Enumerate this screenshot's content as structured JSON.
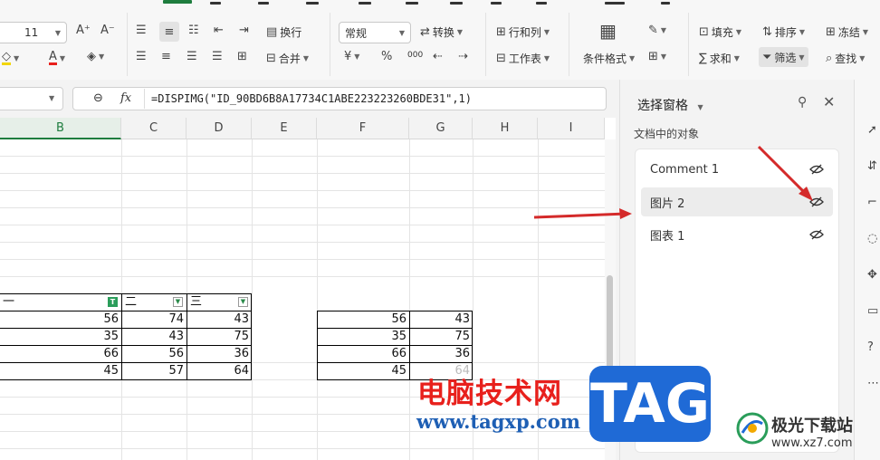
{
  "ribbon": {
    "font_size": "11",
    "wrap_label": "换行",
    "merge_label": "合并",
    "number_format": "常规",
    "convert_label": "转换",
    "row_col_label": "行和列",
    "worksheet_label": "工作表",
    "conditional_format_label": "条件格式",
    "fill_label": "填充",
    "sort_label": "排序",
    "freeze_label": "冻结",
    "sum_label": "求和",
    "filter_label": "筛选",
    "find_label": "查找",
    "currency_symbol": "¥",
    "percent_symbol": "%",
    "thousands_symbol": "000",
    "accent_color": "#1e7d3e"
  },
  "formula_bar": {
    "fx_label": "fx",
    "formula": "=DISPIMG(\"ID_90BD6B8A17734C1ABE223223260BDE31\",1)"
  },
  "sheet": {
    "columns": [
      "B",
      "C",
      "D",
      "E",
      "F",
      "G",
      "H",
      "I"
    ],
    "table1_headers": [
      "一",
      "二",
      "三"
    ],
    "table1_rows": [
      [
        "56",
        "74",
        "43"
      ],
      [
        "35",
        "43",
        "75"
      ],
      [
        "66",
        "56",
        "36"
      ],
      [
        "45",
        "57",
        "64"
      ]
    ],
    "table2_rows": [
      [
        "56",
        "43"
      ],
      [
        "35",
        "75"
      ],
      [
        "66",
        "36"
      ],
      [
        "45",
        "64"
      ]
    ]
  },
  "selection_pane": {
    "title": "选择窗格",
    "subtitle": "文档中的对象",
    "items": [
      {
        "label": "Comment 1"
      },
      {
        "label": "图片 2"
      },
      {
        "label": "图表 1"
      }
    ]
  },
  "watermark": {
    "cn_text": "电脑技术网",
    "url": "www.tagxp.com",
    "tag": "TAG",
    "site_cn": "极光下载站",
    "site_url": "www.xz7.com"
  }
}
